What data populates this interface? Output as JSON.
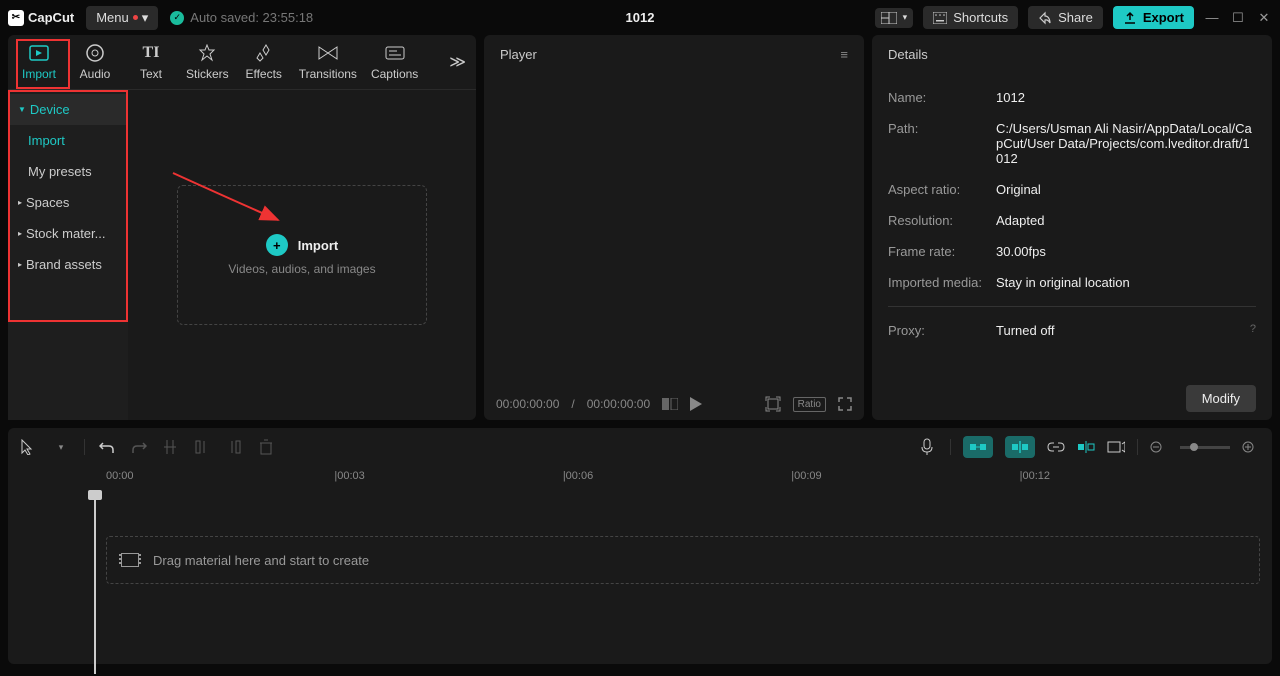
{
  "app": {
    "name": "CapCut",
    "menu_label": "Menu",
    "autosave": "Auto saved: 23:55:18",
    "project_title": "1012"
  },
  "topbar": {
    "shortcuts": "Shortcuts",
    "share": "Share",
    "export": "Export"
  },
  "tabs": [
    "Import",
    "Audio",
    "Text",
    "Stickers",
    "Effects",
    "Transitions",
    "Captions"
  ],
  "sidebar": {
    "device": "Device",
    "import": "Import",
    "my_presets": "My presets",
    "spaces": "Spaces",
    "stock": "Stock mater...",
    "brand": "Brand assets"
  },
  "import_box": {
    "title": "Import",
    "subtitle": "Videos, audios, and images"
  },
  "player": {
    "title": "Player",
    "time_current": "00:00:00:00",
    "time_total": "00:00:00:00",
    "ratio": "Ratio"
  },
  "details": {
    "title": "Details",
    "rows": {
      "name_label": "Name:",
      "name_value": "1012",
      "path_label": "Path:",
      "path_value": "C:/Users/Usman Ali Nasir/AppData/Local/CapCut/User Data/Projects/com.lveditor.draft/1012",
      "aspect_label": "Aspect ratio:",
      "aspect_value": "Original",
      "resolution_label": "Resolution:",
      "resolution_value": "Adapted",
      "framerate_label": "Frame rate:",
      "framerate_value": "30.00fps",
      "imported_label": "Imported media:",
      "imported_value": "Stay in original location",
      "proxy_label": "Proxy:",
      "proxy_value": "Turned off"
    },
    "modify": "Modify"
  },
  "timeline": {
    "marks": [
      "00:00",
      "00:03",
      "00:06",
      "00:09",
      "00:12"
    ],
    "drop_hint": "Drag material here and start to create"
  }
}
